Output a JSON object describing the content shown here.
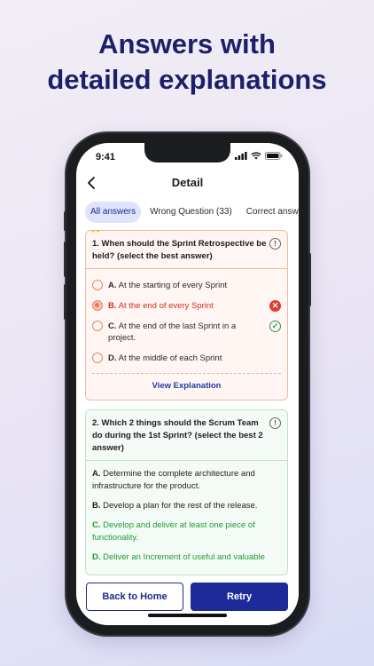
{
  "headline": {
    "line1": "Answers with",
    "line2": "detailed explanations"
  },
  "status_bar": {
    "time": "9:41",
    "icons": [
      "signal-icon",
      "wifi-icon",
      "battery-icon"
    ]
  },
  "nav": {
    "back_icon": "chevron-left-icon",
    "title": "Detail"
  },
  "tabs": [
    {
      "label": "All answers",
      "active": true
    },
    {
      "label": "Wrong Question (33)",
      "active": false
    },
    {
      "label": "Correct answ",
      "active": false
    }
  ],
  "questions": [
    {
      "text": "1. When should the Sprint Retrospective be held? (select the best answer)",
      "status": "wrong",
      "options": [
        {
          "letter": "A.",
          "text": "At the starting of every Sprint",
          "state": "none"
        },
        {
          "letter": "B.",
          "text": "At the end of every Sprint",
          "state": "selected-wrong"
        },
        {
          "letter": "C.",
          "text": "At the end of the last Sprint in a project.",
          "state": "correct"
        },
        {
          "letter": "D.",
          "text": "At the middle of each Sprint",
          "state": "none"
        }
      ],
      "view_explanation": "View Explanation"
    },
    {
      "text": "2. Which 2 things should the Scrum Team do during the 1st Sprint? (select the best 2 answer)",
      "status": "right",
      "options": [
        {
          "letter": "A.",
          "text": "Determine the complete architecture and infrastructure for the product.",
          "state": "none"
        },
        {
          "letter": "B.",
          "text": "Develop a plan for the rest of the release.",
          "state": "none"
        },
        {
          "letter": "C.",
          "text": "Develop and deliver at least one piece of functionality.",
          "state": "correct"
        },
        {
          "letter": "D.",
          "text": "Deliver an Increment of useful and valuable",
          "state": "correct"
        }
      ]
    }
  ],
  "buttons": {
    "back_home": "Back to Home",
    "retry": "Retry"
  },
  "colors": {
    "brand": "#1f2a9a",
    "wrong": "#d62a24",
    "correct": "#1f9a3a",
    "headline": "#1e1f6b"
  }
}
